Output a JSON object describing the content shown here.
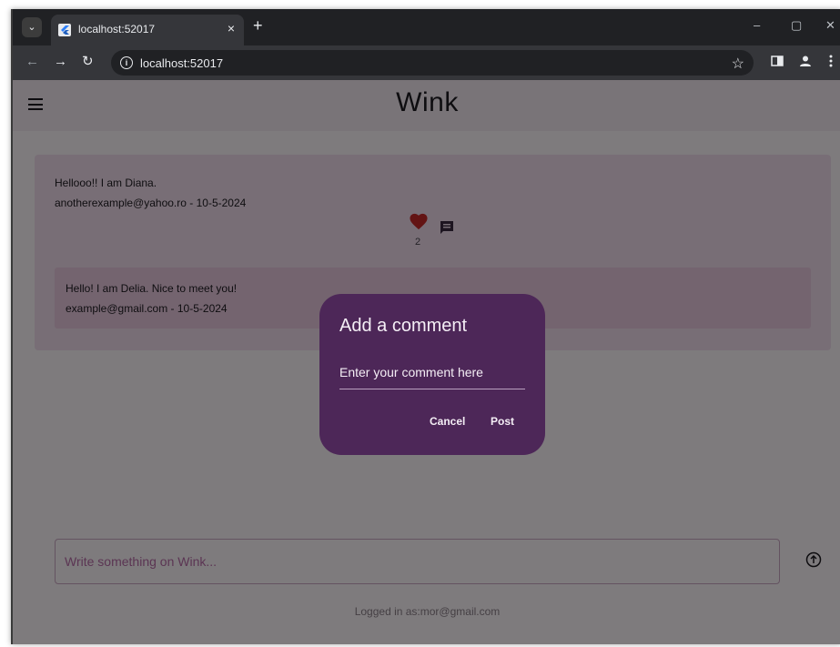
{
  "browser": {
    "tab_title": "localhost:52017",
    "tab_close": "×",
    "new_tab": "+",
    "url": "localhost:52017",
    "window_controls": [
      "–",
      "▢",
      "✕"
    ]
  },
  "app": {
    "title": "Wink"
  },
  "post": {
    "text": "Hellooo!! I am Diana.",
    "meta": "anotherexample@yahoo.ro - 10-5-2024",
    "like_count": "2",
    "like_color": "#c62828"
  },
  "comment": {
    "text": "Hello! I am Delia. Nice to meet you!",
    "meta": "example@gmail.com - 10-5-2024"
  },
  "composer": {
    "placeholder": "Write something on Wink..."
  },
  "footer": {
    "logged_in": "Logged in as:mor@gmail.com"
  },
  "dialog": {
    "title": "Add a comment",
    "input_hint": "Enter your comment here",
    "cancel_label": "Cancel",
    "post_label": "Post"
  },
  "icons": [
    "tab-search-icon",
    "flutter-favicon-icon",
    "back-icon",
    "forward-icon",
    "reload-icon",
    "info-icon",
    "star-icon",
    "sidepanel-icon",
    "profile-icon",
    "more-vert-icon",
    "menu-icon",
    "heart-icon",
    "comment-icon",
    "send-icon"
  ]
}
